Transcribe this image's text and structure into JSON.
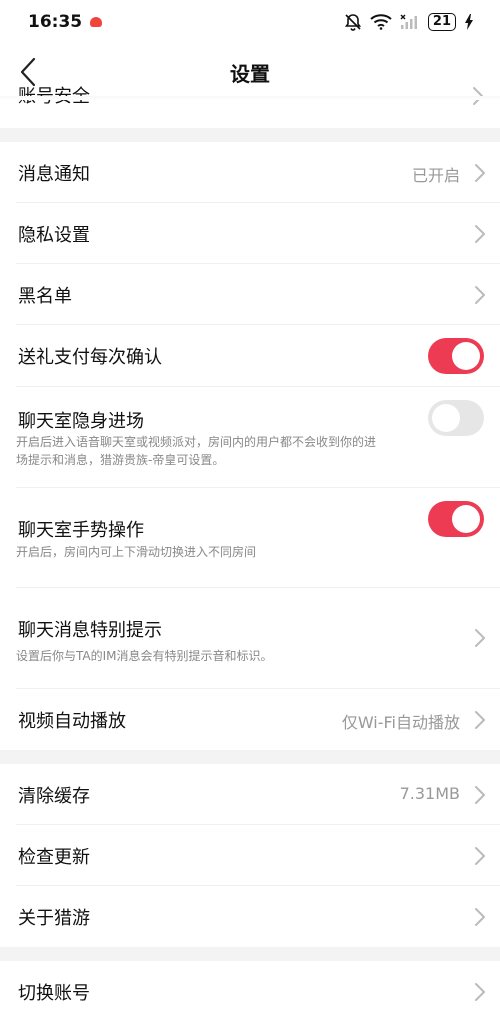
{
  "status_bar": {
    "time": "16:35",
    "battery": "21"
  },
  "nav": {
    "title": "设置"
  },
  "partial_item": {
    "label": "账号安全"
  },
  "items": [
    {
      "label": "消息通知",
      "value": "已开启"
    },
    {
      "label": "隐私设置"
    },
    {
      "label": "黑名单"
    },
    {
      "label": "送礼支付每次确认",
      "toggle": "on"
    },
    {
      "label": "聊天室隐身进场",
      "sub": "开启后进入语音聊天室或视频派对，房间内的用户都不会收到你的进场提示和消息，猎游贵族-帝皇可设置。",
      "toggle": "off"
    },
    {
      "label": "聊天室手势操作",
      "sub": "开启后，房间内可上下滑动切换进入不同房间",
      "toggle": "on"
    },
    {
      "label": "聊天消息特别提示",
      "sub": "设置后你与TA的IM消息会有特别提示音和标识。"
    },
    {
      "label": "视频自动播放",
      "value": "仅Wi-Fi自动播放"
    },
    {
      "label": "清除缓存",
      "value": "7.31MB"
    },
    {
      "label": "检查更新"
    },
    {
      "label": "关于猎游"
    },
    {
      "label": "切换账号"
    }
  ],
  "colors": {
    "accent": "#ee3b54",
    "section_gap": "#f3f3f3",
    "secondary_text": "#999999"
  }
}
